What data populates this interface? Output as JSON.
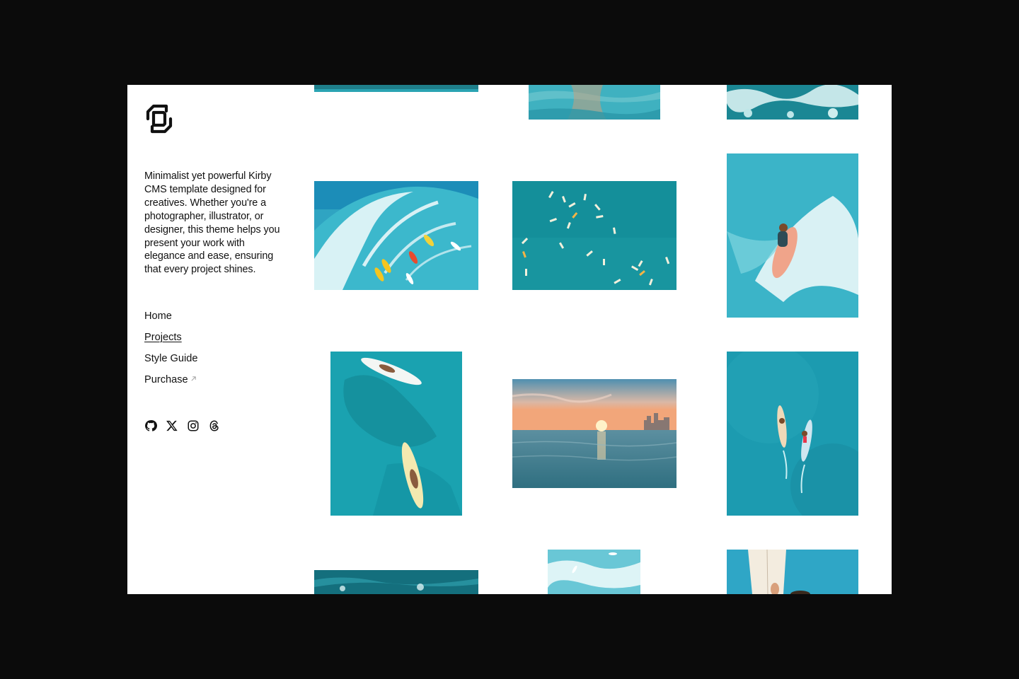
{
  "site": {
    "logo": "brand-logo-icon",
    "tagline": "Minimalist yet powerful Kirby CMS template designed for creatives. Whether you're a photographer, illustrator, or designer, this theme helps you present your work with elegance and ease, ensuring that every project shines."
  },
  "nav": {
    "items": [
      {
        "label": "Home",
        "active": false
      },
      {
        "label": "Projects",
        "active": true
      },
      {
        "label": "Style Guide",
        "active": false
      },
      {
        "label": "Purchase",
        "active": false,
        "external": true
      }
    ]
  },
  "social": [
    "github-icon",
    "x-icon",
    "instagram-icon",
    "threads-icon"
  ],
  "gallery": {
    "images": [
      {
        "name": "photo-ocean-wave-top-partial",
        "subject": "ocean"
      },
      {
        "name": "photo-shallow-water-ripples-partial",
        "subject": "water"
      },
      {
        "name": "photo-whitewater-foam-partial",
        "subject": "foam"
      },
      {
        "name": "photo-surfers-riding-wave",
        "subject": "surfers on wave"
      },
      {
        "name": "photo-surfers-aerial-lineup",
        "subject": "surfers aerial"
      },
      {
        "name": "photo-surfer-on-pink-board",
        "subject": "surfer"
      },
      {
        "name": "photo-surfers-on-longboards",
        "subject": "longboards"
      },
      {
        "name": "photo-sunset-over-ocean",
        "subject": "sunset"
      },
      {
        "name": "photo-surfers-paddling-aerial",
        "subject": "paddling surfers"
      },
      {
        "name": "photo-ocean-waves-bottom-partial",
        "subject": "ocean"
      },
      {
        "name": "photo-whitewater-surfer-partial",
        "subject": "whitewater"
      },
      {
        "name": "photo-surfboard-closeup-partial",
        "subject": "surfboard"
      }
    ]
  },
  "colors": {
    "background": "#0b0b0b",
    "page": "#ffffff",
    "text": "#111111",
    "ocean": "#1fa6b8",
    "deep_ocean": "#117f8f",
    "foam": "#e9f7f8"
  }
}
